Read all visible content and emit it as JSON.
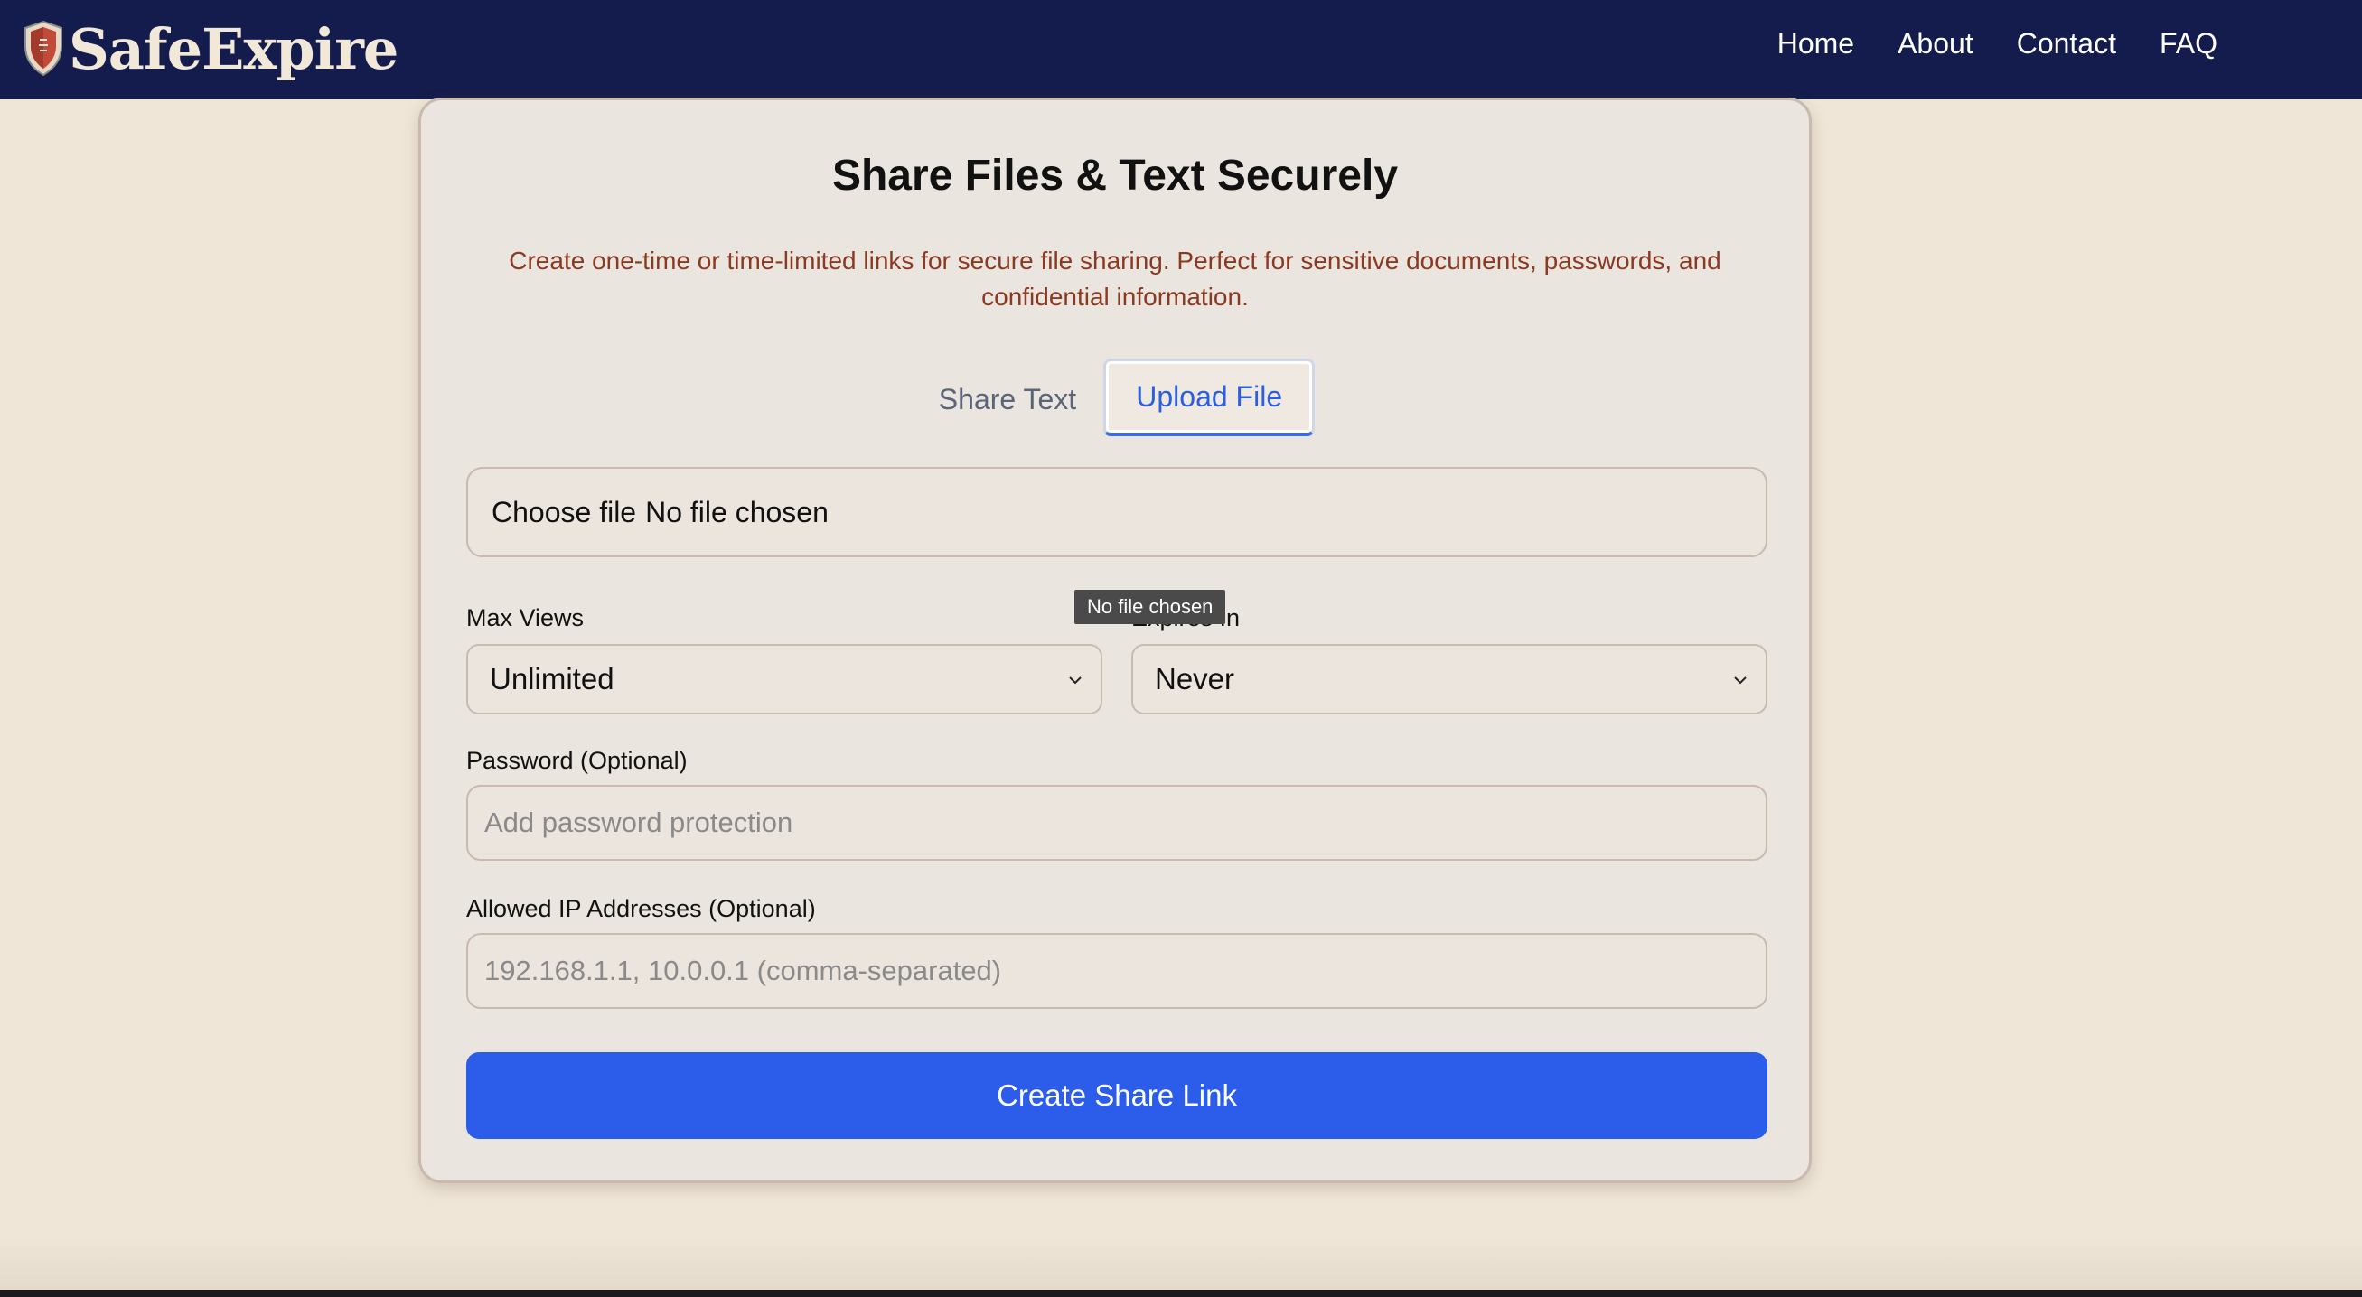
{
  "brand": {
    "name": "SafeExpire",
    "logo_icon": "shield-icon",
    "colors": {
      "navbar": "#141c4d",
      "shield_red": "#c24a38",
      "shield_light": "#e8d9c6"
    }
  },
  "nav": {
    "links": [
      "Home",
      "About",
      "Contact",
      "FAQ"
    ]
  },
  "card": {
    "title": "Share Files & Text Securely",
    "subtitle": "Create one-time or time-limited links for secure file sharing. Perfect for sensitive documents, passwords, and confidential information."
  },
  "tabs": {
    "items": [
      {
        "label": "Share Text",
        "active": false
      },
      {
        "label": "Upload File",
        "active": true
      }
    ],
    "accent_color": "#2a5fe0"
  },
  "file_input": {
    "button_label": "Choose file",
    "status": "No file chosen",
    "tooltip": "No file chosen"
  },
  "form": {
    "max_views": {
      "label": "Max Views",
      "value": "Unlimited"
    },
    "expires_in": {
      "label": "Expires In",
      "value": "Never"
    },
    "password": {
      "label": "Password (Optional)",
      "value": "",
      "placeholder": "Add password protection"
    },
    "allowed_ips": {
      "label": "Allowed IP Addresses (Optional)",
      "value": "",
      "placeholder": "192.168.1.1, 10.0.0.1 (comma-separated)"
    },
    "submit_label": "Create Share Link",
    "submit_color": "#2b5cea"
  }
}
